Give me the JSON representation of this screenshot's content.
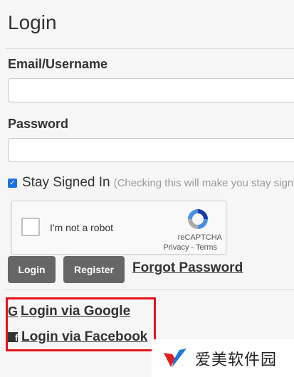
{
  "page": {
    "title": "Login"
  },
  "form": {
    "email_label": "Email/Username",
    "email_value": "",
    "password_label": "Password",
    "password_value": "",
    "stay_signed_in_label": "Stay Signed In",
    "stay_signed_in_hint": "(Checking this will make you stay sign",
    "stay_signed_in_checked": true
  },
  "recaptcha": {
    "label": "I'm not a robot",
    "brand": "reCAPTCHA",
    "links": "Privacy - Terms"
  },
  "actions": {
    "login_label": "Login",
    "register_label": "Register",
    "forgot_label": "Forgot Password"
  },
  "social": {
    "google_glyph": "G",
    "google_label": "Login via Google",
    "facebook_glyph": "f",
    "facebook_label": "Login via Facebook",
    "highlight_color": "#e8131a"
  },
  "watermark": {
    "text": "爱美软件园"
  },
  "colors": {
    "button_bg": "#666666",
    "checkbox": "#1a73e8",
    "page_bg": "#f6f6f6"
  }
}
